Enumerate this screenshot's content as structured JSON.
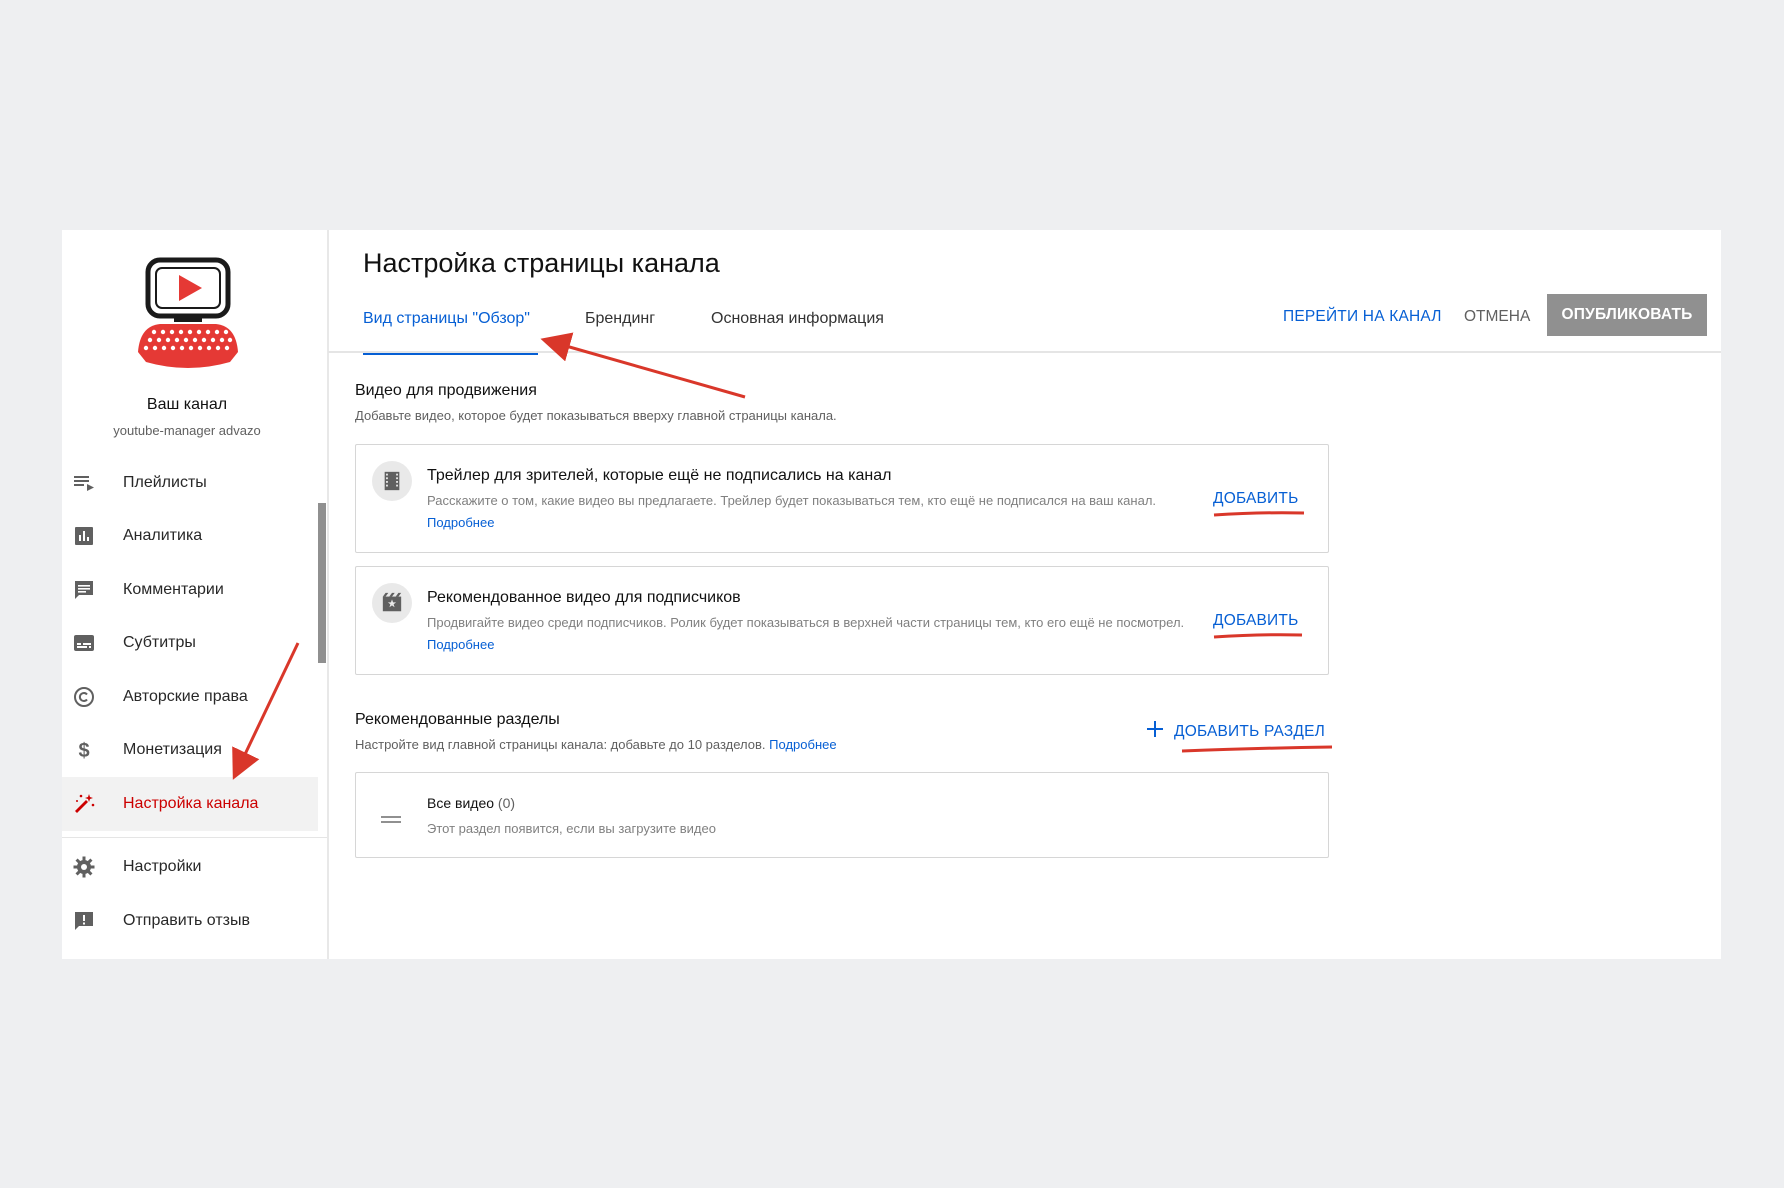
{
  "sidebar": {
    "channel_name": "Ваш канал",
    "channel_handle": "youtube-manager advazo",
    "items": [
      {
        "label": "Плейлисты",
        "icon": "playlist-icon"
      },
      {
        "label": "Аналитика",
        "icon": "analytics-icon"
      },
      {
        "label": "Комментарии",
        "icon": "comments-icon"
      },
      {
        "label": "Субтитры",
        "icon": "subtitles-icon"
      },
      {
        "label": "Авторские права",
        "icon": "copyright-icon"
      },
      {
        "label": "Монетизация",
        "icon": "dollar-icon"
      },
      {
        "label": "Настройка канала",
        "icon": "magic-wand-icon",
        "active": true
      }
    ],
    "bottom_items": [
      {
        "label": "Настройки",
        "icon": "gear-icon"
      },
      {
        "label": "Отправить отзыв",
        "icon": "feedback-icon"
      }
    ]
  },
  "header": {
    "title": "Настройка страницы канала",
    "tabs": [
      {
        "label": "Вид страницы \"Обзор\"",
        "active": true
      },
      {
        "label": "Брендинг"
      },
      {
        "label": "Основная информация"
      }
    ],
    "go_to_channel": "ПЕРЕЙТИ НА КАНАЛ",
    "cancel": "ОТМЕНА",
    "publish": "ОПУБЛИКОВАТЬ"
  },
  "promo": {
    "title": "Видео для продвижения",
    "description": "Добавьте видео, которое будет показываться вверху главной страницы канала.",
    "cards": [
      {
        "title": "Трейлер для зрителей, которые ещё не подписались на канал",
        "description": "Расскажите о том, какие видео вы предлагаете. Трейлер будет показываться тем, кто ещё не подписался на ваш канал.",
        "more": "Подробнее",
        "add": "ДОБАВИТЬ",
        "icon": "film-icon"
      },
      {
        "title": "Рекомендованное видео для подписчиков",
        "description": "Продвигайте видео среди подписчиков. Ролик будет показываться в верхней части страницы тем, кто его ещё не посмотрел.",
        "more": "Подробнее",
        "add": "ДОБАВИТЬ",
        "icon": "featured-video-icon"
      }
    ]
  },
  "featured": {
    "title": "Рекомендованные разделы",
    "description": "Настройте вид главной страницы канала: добавьте до 10 разделов.",
    "more": "Подробнее",
    "add_section": "ДОБАВИТЬ РАЗДЕЛ",
    "section": {
      "title": "Все видео",
      "count": "(0)",
      "description": "Этот раздел появится, если вы загрузите видео"
    }
  },
  "colors": {
    "accent": "#065fd4",
    "active_red": "#cc0000",
    "annotation_red": "#d9372a",
    "publish_bg": "#909090"
  }
}
